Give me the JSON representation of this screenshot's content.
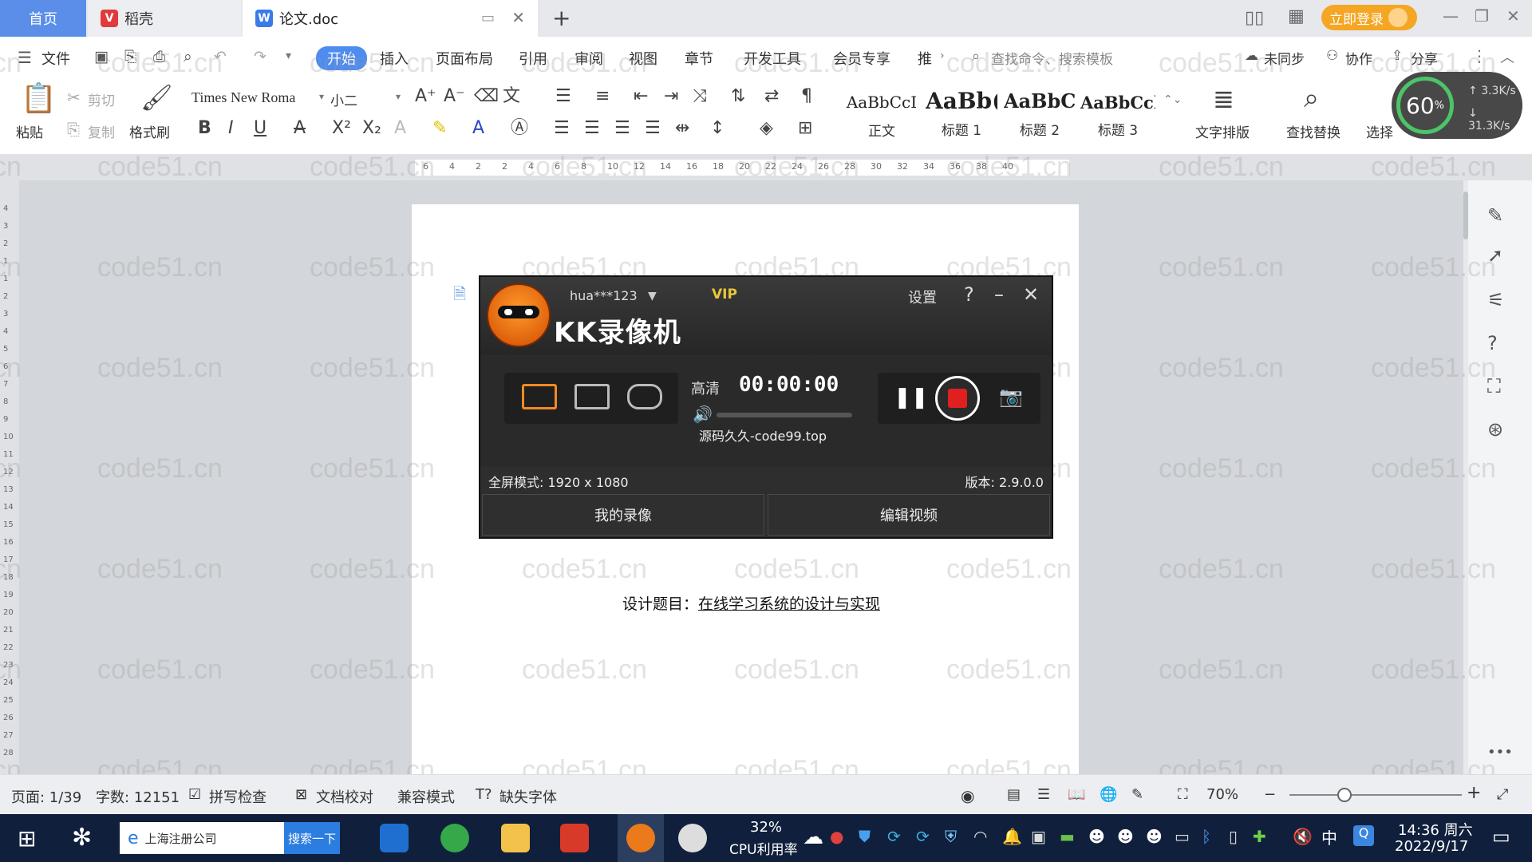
{
  "tabs": [
    {
      "label": "首页"
    },
    {
      "label": "稻壳"
    },
    {
      "label": "论文.doc"
    }
  ],
  "titlebar": {
    "login_label": "立即登录"
  },
  "menu": {
    "items": [
      "文件",
      "开始",
      "插入",
      "页面布局",
      "引用",
      "审阅",
      "视图",
      "章节",
      "开发工具",
      "会员专享",
      "推"
    ],
    "search_cmd": "查找命令、搜索模板",
    "unsynced": "未同步",
    "collab": "协作",
    "share": "分享"
  },
  "toolbar": {
    "paste": "粘贴",
    "cut": "剪切",
    "copy": "复制",
    "format_painter": "格式刷",
    "font_name": "Times New Roma",
    "font_size": "小二",
    "styles": [
      {
        "sample": "AaBbCcI",
        "label": "正文"
      },
      {
        "sample": "AaBb(",
        "label": "标题 1"
      },
      {
        "sample": "AaBbC",
        "label": "标题 2"
      },
      {
        "sample": "AaBbCcl",
        "label": "标题 3"
      }
    ],
    "text_layout": "文字排版",
    "find_replace": "查找替换",
    "select": "选择"
  },
  "net_meter": {
    "percent": "60",
    "up": "3.3",
    "down": "31.3"
  },
  "ruler": {
    "ticks": [
      "6",
      "4",
      "2",
      "2",
      "4",
      "6",
      "8",
      "10",
      "12",
      "14",
      "16",
      "18",
      "20",
      "22",
      "24",
      "26",
      "28",
      "30",
      "32",
      "34",
      "36",
      "38",
      "40"
    ]
  },
  "vruler": {
    "ticks": [
      "4",
      "3",
      "2",
      "1",
      "1",
      "2",
      "3",
      "4",
      "5",
      "6",
      "7",
      "8",
      "9",
      "10",
      "11",
      "12",
      "13",
      "14",
      "15",
      "16",
      "17",
      "18",
      "19",
      "20",
      "21",
      "22",
      "23",
      "24",
      "25",
      "26",
      "27",
      "28"
    ]
  },
  "watermark": "code51.cn",
  "document": {
    "title_label": "设计题目：",
    "title_value": "在线学习系统的设计与实现"
  },
  "kk": {
    "app_name": "KK录像机",
    "user": "hua***123",
    "vip": "VIP",
    "settings": "设置",
    "quality": "高清",
    "timer": "00:00:00",
    "overlay_text": "源码久久-code99.top",
    "mode_text": "全屏模式: 1920 x 1080",
    "version": "版本: 2.9.0.0",
    "btn_my_videos": "我的录像",
    "btn_edit_video": "编辑视频"
  },
  "statusbar": {
    "page": "页面: 1/39",
    "words": "字数: 12151",
    "spellcheck": "拼写检查",
    "proofread": "文档校对",
    "compat": "兼容模式",
    "missing_font": "缺失字体",
    "zoom": "70%"
  },
  "taskbar": {
    "search_text": "上海注册公司",
    "search_btn": "搜索一下",
    "cpu_percent": "32%",
    "cpu_label": "CPU利用率",
    "ime": "中",
    "time": "14:36 周六",
    "date": "2022/9/17"
  },
  "colors": {
    "accent": "#4e8cf0",
    "record_red": "#e02020",
    "vip_gold": "#e8c73c",
    "orange_login": "#f5a623"
  }
}
